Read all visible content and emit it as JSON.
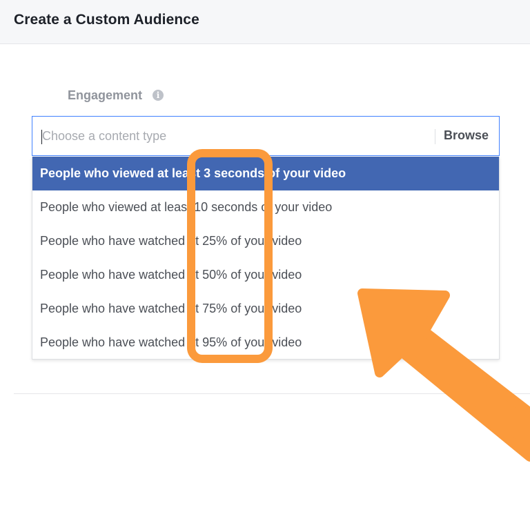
{
  "header": {
    "title": "Create a Custom Audience"
  },
  "form": {
    "label": "Engagement",
    "info_icon_glyph": "i",
    "input": {
      "placeholder": "Choose a content type",
      "browse_label": "Browse"
    },
    "dropdown": {
      "selected_index": 0,
      "items": [
        "People who viewed at least 3 seconds of your video",
        "People who viewed at least 10 seconds of your video",
        "People who have watched at 25% of your video",
        "People who have watched at 50% of your video",
        "People who have watched at 75% of your video",
        "People who have watched at 95% of your video"
      ]
    }
  },
  "icons": {
    "info": "info-icon",
    "annotation": "arrow-icon"
  },
  "colors": {
    "header_bg": "#f6f7f9",
    "selected_bg": "#4267b2",
    "input_border": "#4080ff",
    "annotation": "#fb9a3c"
  }
}
